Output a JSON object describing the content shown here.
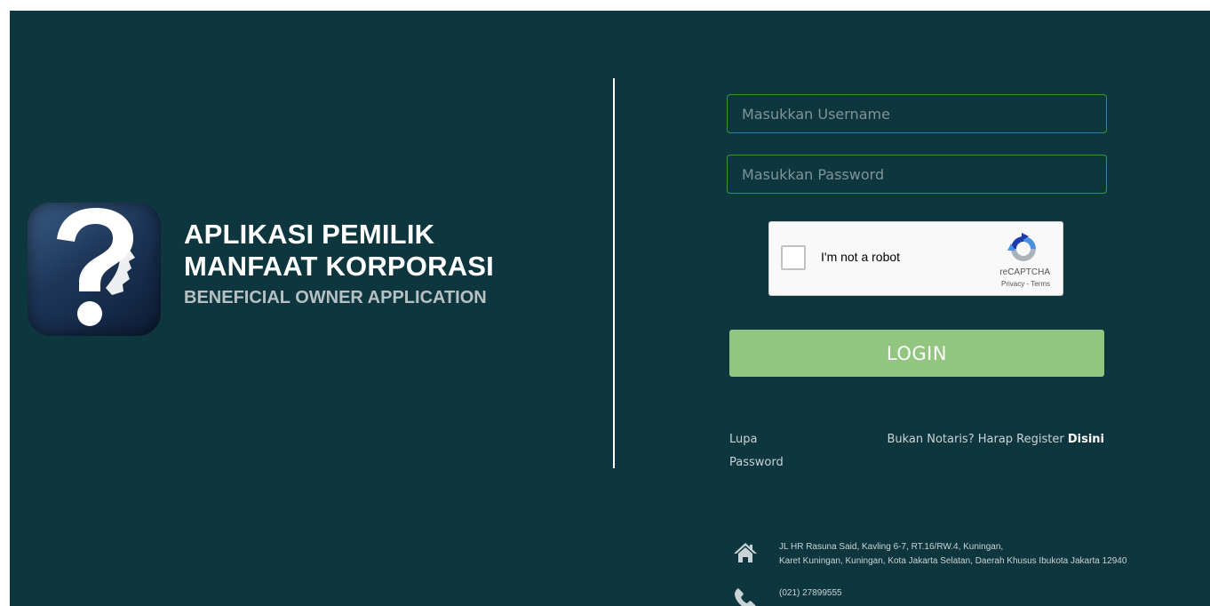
{
  "brand": {
    "title_line1": "APLIKASI PEMILIK",
    "title_line2": "MANFAAT KORPORASI",
    "subtitle": "BENEFICIAL OWNER APPLICATION",
    "logo_icon": "question-head-icon"
  },
  "login": {
    "username_placeholder": "Masukkan Username",
    "password_placeholder": "Masukkan Password",
    "button_label": "LOGIN",
    "button_color": "#92c57f"
  },
  "captcha": {
    "label": "I'm not a robot",
    "brand": "reCAPTCHA",
    "privacy": "Privacy",
    "separator": " - ",
    "terms": "Terms"
  },
  "links": {
    "forgot_password": "Lupa Password",
    "register_prefix": "Bukan Notaris? Harap Register ",
    "register_link": "Disini"
  },
  "contact": {
    "address_line1": "JL HR Rasuna Said, Kavling 6-7, RT.16/RW.4, Kuningan,",
    "address_line2": "Karet Kuningan, Kuningan, Kota Jakarta Selatan, Daerah Khusus Ibukota Jakarta 12940",
    "phone": "(021) 27899555",
    "address_icon": "home-icon",
    "phone_icon": "phone-icon"
  },
  "colors": {
    "background": "#0e363e",
    "input_border": "#2b9a3c"
  }
}
